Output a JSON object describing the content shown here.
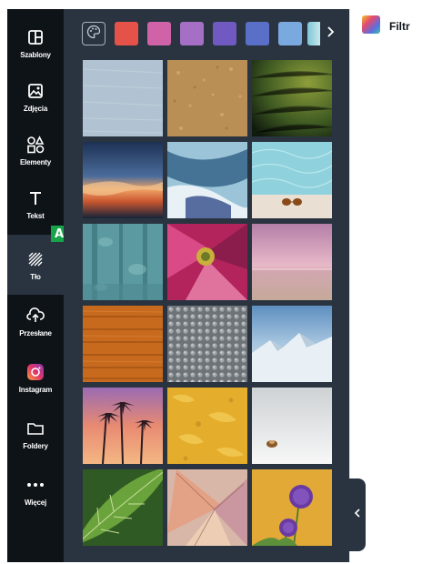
{
  "sidebar": {
    "items": [
      {
        "label": "Szablony",
        "icon": "template-icon"
      },
      {
        "label": "Zdjęcia",
        "icon": "image-icon"
      },
      {
        "label": "Elementy",
        "icon": "shapes-icon"
      },
      {
        "label": "Tekst",
        "icon": "text-icon"
      },
      {
        "label": "Tło",
        "icon": "background-pattern-icon",
        "active": true
      },
      {
        "label": "Przesłane",
        "icon": "cloud-upload-icon"
      },
      {
        "label": "Instagram",
        "icon": "instagram-icon"
      },
      {
        "label": "Foldery",
        "icon": "folder-icon"
      },
      {
        "label": "Więcej",
        "icon": "more-dots-icon"
      }
    ]
  },
  "swatches": {
    "colors": [
      "#e5524a",
      "#d062a8",
      "#a56fc6",
      "#7059c0",
      "#5a6fc8",
      "#7aa9df"
    ],
    "gradient_partial": [
      "#7fc5d6",
      "#c7e8ee"
    ],
    "palette_icon": "palette-icon",
    "next_icon": "chevron-right-icon"
  },
  "backgrounds": [
    {
      "name": "light-blue-fabric"
    },
    {
      "name": "gold-sand-texture"
    },
    {
      "name": "green-stone-wall"
    },
    {
      "name": "sunset-clouds-sky"
    },
    {
      "name": "blue-abstract-wave"
    },
    {
      "name": "pool-water-sunglasses"
    },
    {
      "name": "teal-weathered-wall"
    },
    {
      "name": "pink-flower-macro"
    },
    {
      "name": "pink-beach-horizon"
    },
    {
      "name": "orange-wood-planks"
    },
    {
      "name": "grey-metal-texture"
    },
    {
      "name": "snowy-mountains"
    },
    {
      "name": "palm-trees-sunset"
    },
    {
      "name": "yellow-paint-texture"
    },
    {
      "name": "white-minimal-shell"
    },
    {
      "name": "green-leaf"
    },
    {
      "name": "butterfly-wing-pastel"
    },
    {
      "name": "purple-allium-flowers"
    }
  ],
  "toolbar": {
    "filter_label": "Filtr",
    "filter_icon": "color-filter-icon"
  },
  "collapse_icon": "chevron-left-icon",
  "annotation": {
    "label": "A",
    "color": "#16a34a"
  }
}
